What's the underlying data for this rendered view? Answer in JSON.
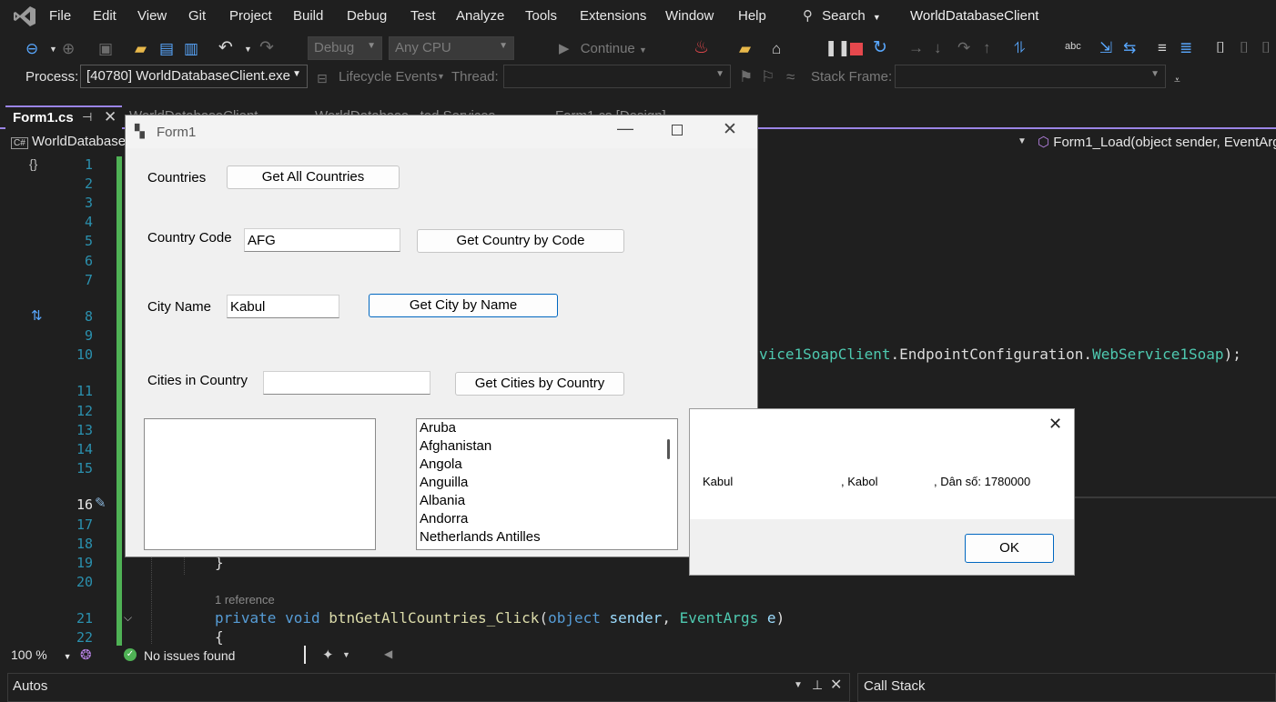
{
  "menubar": {
    "items": [
      "File",
      "Edit",
      "View",
      "Git",
      "Project",
      "Build",
      "Debug",
      "Test",
      "Analyze",
      "Tools",
      "Extensions",
      "Window",
      "Help"
    ],
    "search_label": "Search",
    "solution_name": "WorldDatabaseClient"
  },
  "toolbar": {
    "configuration": "Debug",
    "platform": "Any CPU",
    "continue_label": "Continue",
    "process_label": "Process:",
    "process_value": "[40780] WorldDatabaseClient.exe",
    "lifecycle_label": "Lifecycle Events",
    "thread_label": "Thread:",
    "stack_frame_label": "Stack Frame:"
  },
  "tabs": {
    "active": "Form1.cs",
    "others": [
      "WorldDatabaseClient",
      "WorldDatabase...ted Services",
      "Form1.cs [Design]"
    ]
  },
  "navbar": {
    "project": "WorldDatabase",
    "member": "Form1_Load(object sender, EventArg"
  },
  "editor": {
    "line_numbers": [
      "1",
      "2",
      "3",
      "4",
      "5",
      "6",
      "7",
      "8",
      "9",
      "10",
      "11",
      "12",
      "13",
      "14",
      "15",
      "16",
      "17",
      "18",
      "19",
      "20",
      "21",
      "22"
    ],
    "line10_code_a": "vice1SoapClient",
    "line10_code_b": ".EndpointConfiguration.",
    "line10_code_c": "WebService1Soap",
    "line10_code_d": ");",
    "line19_code": "}",
    "codelens": "1 reference",
    "line21_kw1": "private",
    "line21_kw2": "void",
    "line21_fn": "btnGetAllCountries_Click",
    "line21_p1": "(",
    "line21_kw3": "object",
    "line21_v1": "sender",
    "line21_p2": ", ",
    "line21_ty": "EventArgs",
    "line21_v2": "e",
    "line21_p3": ")",
    "line22_code": "{"
  },
  "statusbar": {
    "zoom": "100 %",
    "issues": "No issues found"
  },
  "panels": {
    "autos": "Autos",
    "callstack": "Call Stack"
  },
  "form1": {
    "title": "Form1",
    "countries_label": "Countries",
    "get_all_countries": "Get All Countries",
    "country_code_label": "Country Code",
    "country_code_value": "AFG",
    "get_country_by_code": "Get Country by Code",
    "city_name_label": "City Name",
    "city_name_value": "Kabul",
    "get_city_by_name": "Get City by Name",
    "cities_in_country_label": "Cities in Country",
    "cities_in_country_value": "",
    "get_cities_by_country": "Get Cities by Country",
    "country_list": [
      "Aruba",
      "Afghanistan",
      "Angola",
      "Anguilla",
      "Albania",
      "Andorra",
      "Netherlands Antilles"
    ]
  },
  "msgbox": {
    "city": "Kabul",
    "district": ", Kabol",
    "population": ", Dân số: 1780000",
    "ok_label": "OK"
  },
  "colors": {
    "accent": "#9b84e6",
    "change_bar": "#4fb255",
    "debug_blue": "#59a8ff",
    "stop_red": "#e5484d"
  }
}
